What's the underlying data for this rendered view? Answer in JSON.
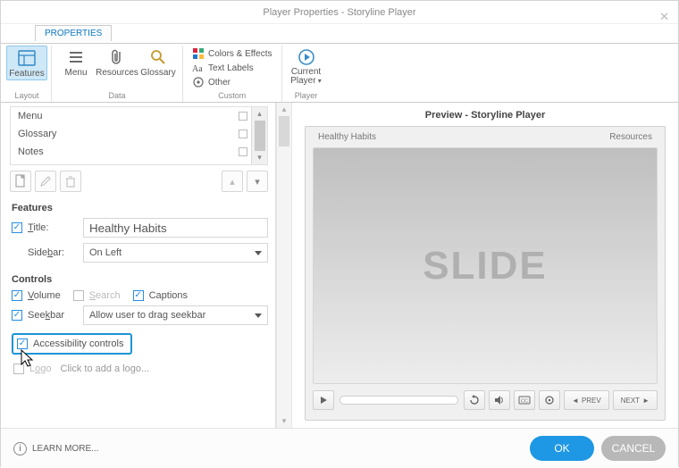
{
  "window": {
    "title": "Player Properties - Storyline Player"
  },
  "tabstrip": {
    "properties": "PROPERTIES"
  },
  "ribbon": {
    "features": "Features",
    "menu": "Menu",
    "resources": "Resources",
    "glossary": "Glossary",
    "colors_effects": "Colors & Effects",
    "text_labels": "Text Labels",
    "other": "Other",
    "current_player": "Current Player",
    "group_layout": "Layout",
    "group_data": "Data",
    "group_custom": "Custom",
    "group_player": "Player"
  },
  "tabs_list": {
    "items": [
      "Menu",
      "Glossary",
      "Notes"
    ]
  },
  "features": {
    "section": "Features",
    "title_label": "Title:",
    "title_value": "Healthy Habits",
    "sidebar_label": "Sidebar:",
    "sidebar_value": "On Left"
  },
  "controls": {
    "section": "Controls",
    "volume": "Volume",
    "search": "Search",
    "captions": "Captions",
    "seekbar": "Seekbar",
    "seekbar_mode": "Allow user to drag seekbar",
    "accessibility": "Accessibility controls",
    "logo": "Logo",
    "logo_hint": "Click to add a logo..."
  },
  "preview": {
    "title": "Preview - Storyline Player",
    "project": "Healthy Habits",
    "resources": "Resources",
    "slide_text": "SLIDE",
    "prev": "PREV",
    "next": "NEXT"
  },
  "footer": {
    "learn_more": "LEARN MORE...",
    "ok": "OK",
    "cancel": "CANCEL"
  }
}
